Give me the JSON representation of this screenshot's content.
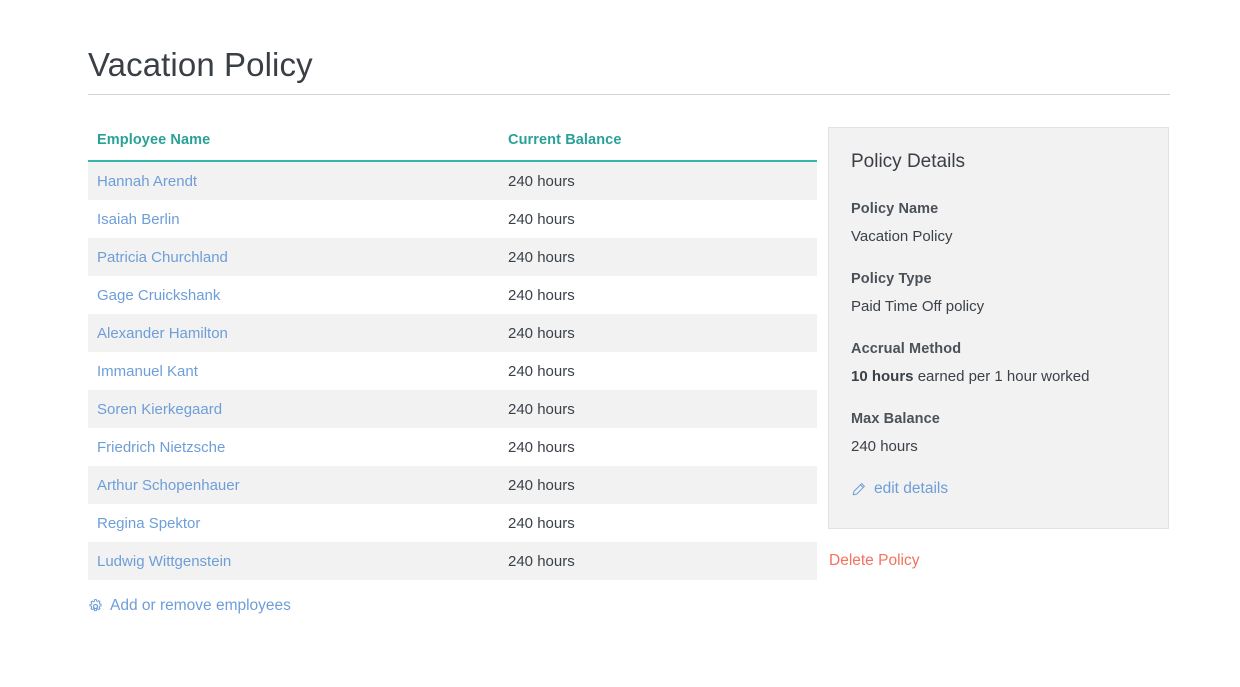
{
  "page": {
    "title": "Vacation Policy"
  },
  "table": {
    "columns": [
      {
        "key": "name",
        "label": "Employee Name"
      },
      {
        "key": "balance",
        "label": "Current Balance"
      }
    ],
    "rows": [
      {
        "name": "Hannah Arendt",
        "balance": "240 hours"
      },
      {
        "name": "Isaiah Berlin",
        "balance": "240 hours"
      },
      {
        "name": "Patricia Churchland",
        "balance": "240 hours"
      },
      {
        "name": "Gage Cruickshank",
        "balance": "240 hours"
      },
      {
        "name": "Alexander Hamilton",
        "balance": "240 hours"
      },
      {
        "name": "Immanuel Kant",
        "balance": "240 hours"
      },
      {
        "name": "Soren Kierkegaard",
        "balance": "240 hours"
      },
      {
        "name": "Friedrich Nietzsche",
        "balance": "240 hours"
      },
      {
        "name": "Arthur Schopenhauer",
        "balance": "240 hours"
      },
      {
        "name": "Regina Spektor",
        "balance": "240 hours"
      },
      {
        "name": "Ludwig Wittgenstein",
        "balance": "240 hours"
      }
    ],
    "add_remove_label": "Add or remove employees",
    "add_remove_icon": "gear-icon"
  },
  "details": {
    "heading": "Policy Details",
    "fields": [
      {
        "label": "Policy Name",
        "value": "Vacation Policy"
      },
      {
        "label": "Policy Type",
        "value": "Paid Time Off policy"
      },
      {
        "label": "Accrual Method",
        "value_strong": "10 hours",
        "value_rest": " earned per 1 hour worked"
      },
      {
        "label": "Max Balance",
        "value": "240 hours"
      }
    ],
    "edit_label": "edit details",
    "edit_icon": "pencil-icon"
  },
  "actions": {
    "delete_label": "Delete Policy"
  },
  "colors": {
    "accent_teal": "#36b5ad",
    "header_teal": "#2aa198",
    "link_blue": "#6e9ed8",
    "danger_red": "#f4715e",
    "panel_bg": "#f2f2f2",
    "row_stripe": "#f2f2f2",
    "text_dark": "#3b4148"
  }
}
